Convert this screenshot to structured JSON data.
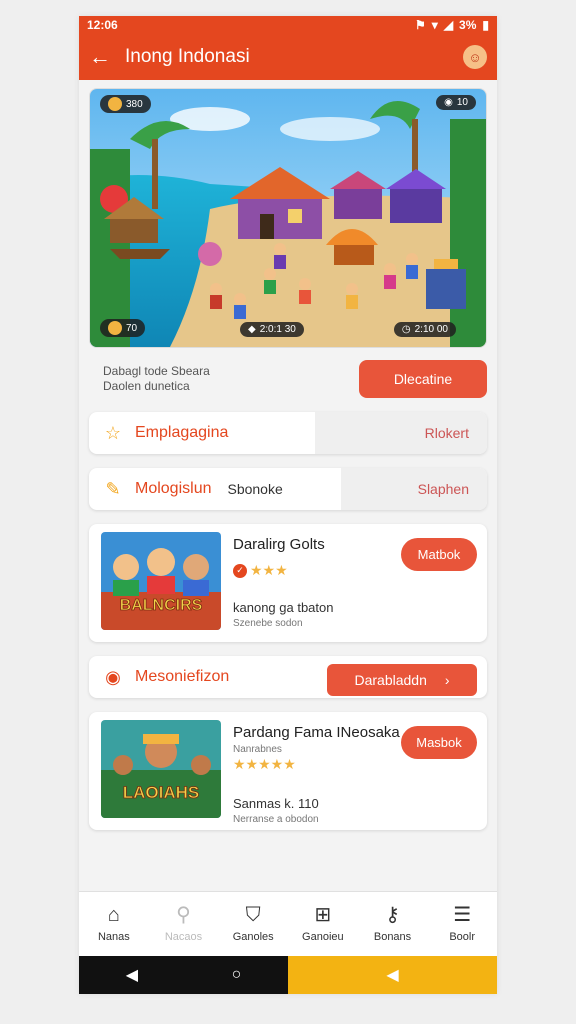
{
  "status": {
    "time": "12:06",
    "battery": "3%"
  },
  "appbar": {
    "title": "Inong Indonasi"
  },
  "banner": {
    "hud_top_left": "380",
    "hud_top_right": "10",
    "hud_bottom_left": "70",
    "hud_bottom_mid": "2:0:1 30",
    "hud_bottom_right": "2:10 00"
  },
  "intro": {
    "line1": "Dabagl tode Sbeara",
    "line2": "Daolen dunetica",
    "button": "Dlecatine"
  },
  "row1": {
    "label": "Emplagagina",
    "right": "Rlokert"
  },
  "row2": {
    "label": "Mologislun",
    "extra": "Sbonoke",
    "right": "Slaphen"
  },
  "card1": {
    "title": "Daralirg Golts",
    "sub1": "kanong ga tbaton",
    "sub2": "Szenebe sodon",
    "button": "Matbok",
    "thumb_text": "BALNCIRS"
  },
  "promo": {
    "label": "Mesoniefizon",
    "button": "Darabladdn"
  },
  "card2": {
    "title": "Pardang Fama INeosaka",
    "tag": "Nanrabnes",
    "sub1": "Sanmas k. 110",
    "sub2": "Nerranse a obodon",
    "button": "Masbok",
    "thumb_text": "LAOIAHS"
  },
  "nav": {
    "items": [
      {
        "label": "Nanas"
      },
      {
        "label": "Nacaos"
      },
      {
        "label": "Ganoles"
      },
      {
        "label": "Ganoieu"
      },
      {
        "label": "Bonans"
      },
      {
        "label": "Boolr"
      }
    ]
  }
}
